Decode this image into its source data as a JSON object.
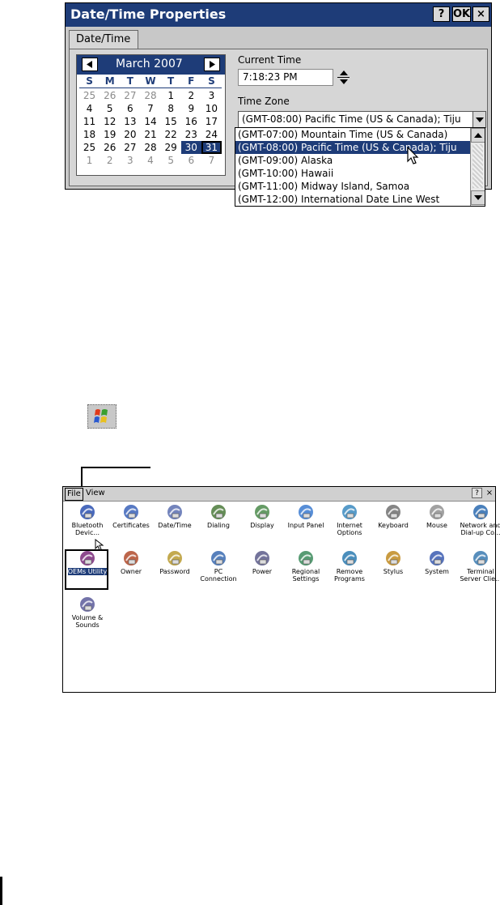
{
  "datetime_dialog": {
    "title": "Date/Time Properties",
    "help_button": "?",
    "ok_button": "OK",
    "close_button": "×",
    "tab": "Date/Time",
    "calendar": {
      "prev_icon": "left-triangle",
      "next_icon": "right-triangle",
      "month_label": "March 2007",
      "weekdays": [
        "S",
        "M",
        "T",
        "W",
        "T",
        "F",
        "S"
      ],
      "days": [
        {
          "d": "25",
          "muted": true
        },
        {
          "d": "26",
          "muted": true
        },
        {
          "d": "27",
          "muted": true
        },
        {
          "d": "28",
          "muted": true
        },
        {
          "d": "1"
        },
        {
          "d": "2"
        },
        {
          "d": "3"
        },
        {
          "d": "4"
        },
        {
          "d": "5"
        },
        {
          "d": "6"
        },
        {
          "d": "7"
        },
        {
          "d": "8"
        },
        {
          "d": "9"
        },
        {
          "d": "10"
        },
        {
          "d": "11"
        },
        {
          "d": "12"
        },
        {
          "d": "13"
        },
        {
          "d": "14"
        },
        {
          "d": "15"
        },
        {
          "d": "16"
        },
        {
          "d": "17"
        },
        {
          "d": "18"
        },
        {
          "d": "19"
        },
        {
          "d": "20"
        },
        {
          "d": "21"
        },
        {
          "d": "22"
        },
        {
          "d": "23"
        },
        {
          "d": "24"
        },
        {
          "d": "25"
        },
        {
          "d": "26"
        },
        {
          "d": "27"
        },
        {
          "d": "28"
        },
        {
          "d": "29"
        },
        {
          "d": "30",
          "selected": true
        },
        {
          "d": "31",
          "selected": true,
          "today": true
        },
        {
          "d": "1",
          "muted": true
        },
        {
          "d": "2",
          "muted": true
        },
        {
          "d": "3",
          "muted": true
        },
        {
          "d": "4",
          "muted": true
        },
        {
          "d": "5",
          "muted": true
        },
        {
          "d": "6",
          "muted": true
        },
        {
          "d": "7",
          "muted": true
        }
      ]
    },
    "current_time_label": "Current Time",
    "current_time_value": "7:18:23 PM",
    "time_zone_label": "Time Zone",
    "time_zone_value": "(GMT-08:00) Pacific Time (US & Canada); Tiju",
    "time_zone_options": [
      {
        "label": "(GMT-07:00) Mountain Time (US & Canada)"
      },
      {
        "label": "(GMT-08:00) Pacific Time (US & Canada); Tiju",
        "selected": true
      },
      {
        "label": "(GMT-09:00) Alaska"
      },
      {
        "label": "(GMT-10:00) Hawaii"
      },
      {
        "label": "(GMT-11:00) Midway Island, Samoa"
      },
      {
        "label": "(GMT-12:00) International Date Line West"
      }
    ]
  },
  "control_panel": {
    "menu": [
      "File",
      "View"
    ],
    "help_button": "?",
    "close_button": "×",
    "items": [
      {
        "label": "Bluetooth Devic...",
        "icon": "bluetooth-icon",
        "color": "#2a50b0"
      },
      {
        "label": "Certificates",
        "icon": "certificates-icon",
        "color": "#3a62b8"
      },
      {
        "label": "Date/Time",
        "icon": "datetime-icon",
        "color": "#5a6fb0"
      },
      {
        "label": "Dialing",
        "icon": "dialing-icon",
        "color": "#4a7a3a"
      },
      {
        "label": "Display",
        "icon": "display-icon",
        "color": "#4a8a4a"
      },
      {
        "label": "Input Panel",
        "icon": "input-panel-icon",
        "color": "#3a7ad0"
      },
      {
        "label": "Internet Options",
        "icon": "internet-options-icon",
        "color": "#3a8ac0"
      },
      {
        "label": "Keyboard",
        "icon": "keyboard-icon",
        "color": "#707070"
      },
      {
        "label": "Mouse",
        "icon": "mouse-icon",
        "color": "#909090"
      },
      {
        "label": "Network and Dial-up Co...",
        "icon": "network-icon",
        "color": "#2a6ab0"
      },
      {
        "label": "OEMs Utility",
        "icon": "oems-utility-icon",
        "color": "#7a2a7a",
        "selected": true
      },
      {
        "label": "Owner",
        "icon": "owner-icon",
        "color": "#b04a2a"
      },
      {
        "label": "Password",
        "icon": "password-icon",
        "color": "#b89a30"
      },
      {
        "label": "PC Connection",
        "icon": "pc-connection-icon",
        "color": "#3a6ab0"
      },
      {
        "label": "Power",
        "icon": "power-icon",
        "color": "#5a5a8a"
      },
      {
        "label": "Regional Settings",
        "icon": "regional-settings-icon",
        "color": "#3a8a5a"
      },
      {
        "label": "Remove Programs",
        "icon": "remove-programs-icon",
        "color": "#2a7ab0"
      },
      {
        "label": "Stylus",
        "icon": "stylus-icon",
        "color": "#c08a20"
      },
      {
        "label": "System",
        "icon": "system-icon",
        "color": "#3a5ab0"
      },
      {
        "label": "Terminal Server Clie...",
        "icon": "terminal-server-icon",
        "color": "#3a7ab0"
      },
      {
        "label": "Volume & Sounds",
        "icon": "volume-sounds-icon",
        "color": "#5a5a9a"
      }
    ]
  }
}
